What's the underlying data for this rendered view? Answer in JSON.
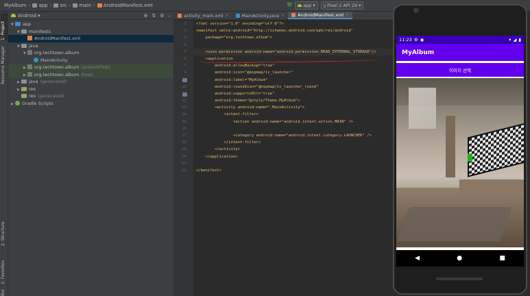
{
  "breadcrumbs": [
    "MyAlbum",
    "app",
    "src",
    "main",
    "AndroidManifest.xml"
  ],
  "toolbar": {
    "run_config": "app",
    "device": "Pixel 2 API 29"
  },
  "side_tabs": [
    "1: Project",
    "Resource Manager",
    "2: Structure",
    "2: Favorites",
    "Build Variants"
  ],
  "project": {
    "view_mode": "Android",
    "tree": [
      {
        "label": "app",
        "depth": 0,
        "icon": "folder-blue",
        "arrow": "▼"
      },
      {
        "label": "manifests",
        "depth": 1,
        "icon": "folder",
        "arrow": "▼"
      },
      {
        "label": "AndroidManifest.xml",
        "depth": 2,
        "icon": "xml",
        "arrow": "",
        "selected": true
      },
      {
        "label": "java",
        "depth": 1,
        "icon": "folder",
        "arrow": "▼"
      },
      {
        "label": "org.techtown.album",
        "depth": 2,
        "icon": "package",
        "arrow": "▼"
      },
      {
        "label": "MainActivity",
        "depth": 3,
        "icon": "class",
        "arrow": ""
      },
      {
        "label": "org.techtown.album",
        "suffix": "(androidTest)",
        "depth": 2,
        "icon": "package",
        "arrow": "▶",
        "highlight": true
      },
      {
        "label": "org.techtown.album",
        "suffix": "(test)",
        "depth": 2,
        "icon": "package",
        "arrow": "▶",
        "highlight": true
      },
      {
        "label": "java",
        "suffix": "(generated)",
        "depth": 1,
        "icon": "folder",
        "arrow": "▶"
      },
      {
        "label": "res",
        "depth": 1,
        "icon": "folder-res",
        "arrow": "▶"
      },
      {
        "label": "res",
        "suffix": "(generated)",
        "depth": 1,
        "icon": "folder-res",
        "arrow": ""
      },
      {
        "label": "Gradle Scripts",
        "depth": 0,
        "icon": "gradle",
        "arrow": "▶"
      }
    ]
  },
  "editor": {
    "tabs": [
      {
        "label": "activity_main.xml",
        "icon_color": "#e8824a",
        "active": false
      },
      {
        "label": "MainActivity.java",
        "icon_color": "#3592c4",
        "active": false
      },
      {
        "label": "AndroidManifest.xml",
        "icon_color": "#e8824a",
        "active": true
      }
    ],
    "lines": [
      {
        "n": "1",
        "text": "<?xml version=\"1.0\" encoding=\"utf-8\"?>"
      },
      {
        "n": "2",
        "text": "<manifest xmlns:android=\"http://schemas.android.com/apk/res/android\""
      },
      {
        "n": "3",
        "text": "    package=\"org.techtown.album\">"
      },
      {
        "n": "4",
        "text": ""
      },
      {
        "n": "5",
        "text": "    <uses-permission android:name=\"android.permission.READ_EXTERNAL_STORAGE\"/>"
      },
      {
        "n": "6",
        "text": "    <application"
      },
      {
        "n": "7",
        "text": "        android:allowBackup=\"true\""
      },
      {
        "n": "8",
        "text": "        android:icon=\"@mipmap/ic_launcher\""
      },
      {
        "n": "9",
        "text": "        android:label=\"MyAlbum\""
      },
      {
        "n": "10",
        "text": "        android:roundIcon=\"@mipmap/ic_launcher_round\""
      },
      {
        "n": "11",
        "text": "        android:supportsRtl=\"true\""
      },
      {
        "n": "12",
        "text": "        android:theme=\"@style/Theme.MyAlbum\">"
      },
      {
        "n": "13",
        "text": "        <activity android:name=\".MainActivity\">"
      },
      {
        "n": "14",
        "text": "            <intent-filter>"
      },
      {
        "n": "15",
        "text": "                <action android:name=\"android.intent.action.MAIN\" />"
      },
      {
        "n": "16",
        "text": ""
      },
      {
        "n": "17",
        "text": "                <category android:name=\"android.intent.category.LAUNCHER\" />"
      },
      {
        "n": "18",
        "text": "            </intent-filter>"
      },
      {
        "n": "19",
        "text": "        </activity>"
      },
      {
        "n": "20",
        "text": "    </application>"
      },
      {
        "n": "21",
        "text": ""
      },
      {
        "n": "22",
        "text": "</manifest>"
      }
    ]
  },
  "emulator": {
    "status_time": "11:23",
    "app_title": "MyAlbum",
    "pick_button_label": "이미지 선택",
    "nav_back": "◀",
    "nav_home": "●",
    "nav_recents": "■"
  },
  "colors": {
    "ide_bg": "#2b2b2b",
    "panel_bg": "#3c3f41",
    "app_primary": "#6200ee",
    "status_bar": "#3700b3",
    "annotation_red": "#d03030"
  }
}
